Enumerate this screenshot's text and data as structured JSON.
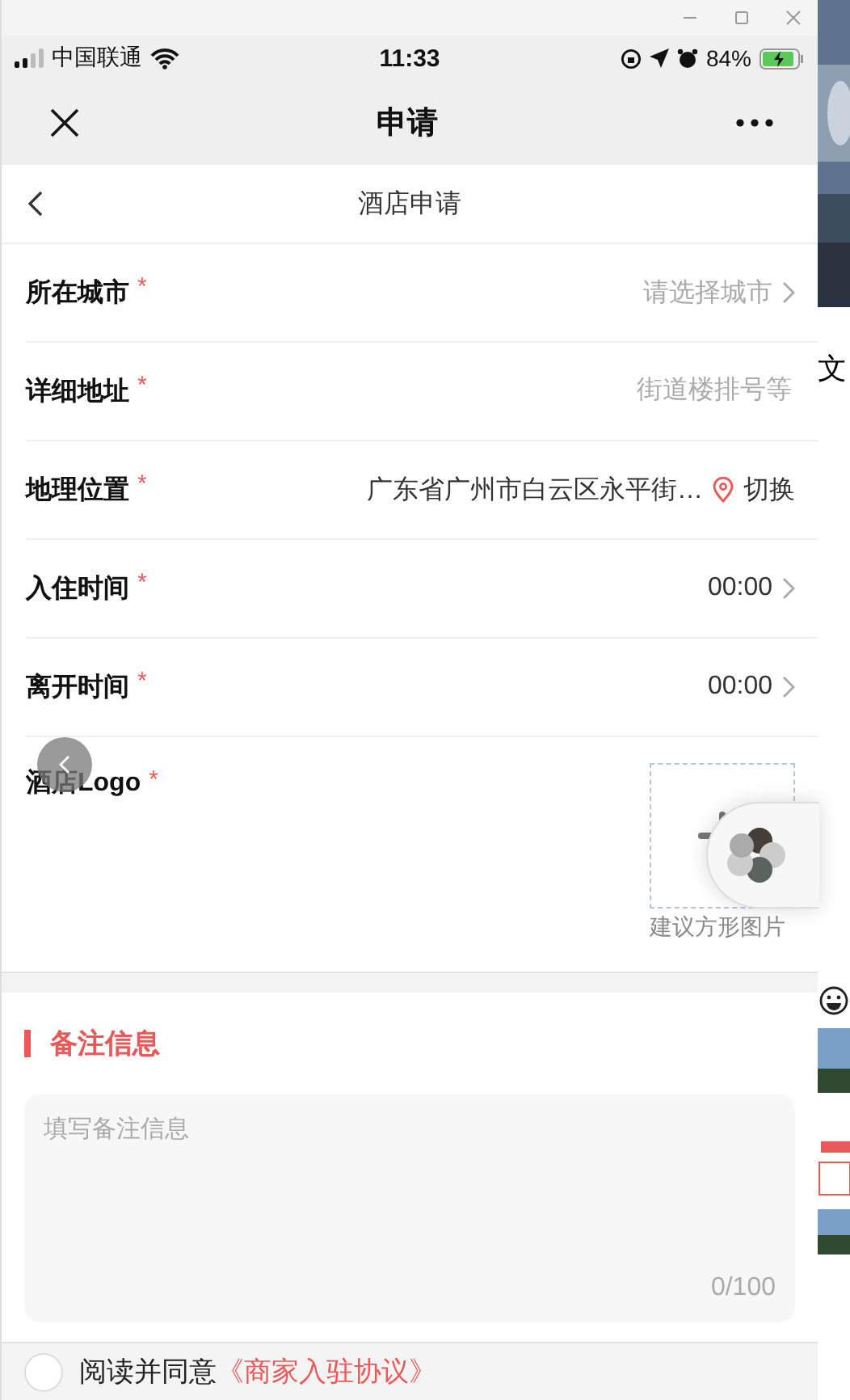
{
  "status_bar": {
    "carrier": "中国联通",
    "time": "11:33",
    "battery": "84%"
  },
  "nav": {
    "title": "申请"
  },
  "subheader": {
    "title": "酒店申请"
  },
  "fields": [
    {
      "kind": "select",
      "label": "所在城市",
      "required": true,
      "placeholder": "请选择城市"
    },
    {
      "kind": "input",
      "label": "详细地址",
      "required": true,
      "placeholder": "街道楼排号等"
    },
    {
      "kind": "location",
      "label": "地理位置",
      "required": true,
      "value": "广东省广州市白云区永平街…",
      "action": "切换"
    },
    {
      "kind": "select",
      "label": "入住时间",
      "required": true,
      "value": "00:00"
    },
    {
      "kind": "select",
      "label": "离开时间",
      "required": true,
      "value": "00:00"
    }
  ],
  "logo": {
    "label": "酒店Logo",
    "required": true,
    "hint": "建议方形图片"
  },
  "remarks": {
    "title": "备注信息",
    "placeholder": "填写备注信息",
    "counter": "0/100"
  },
  "agreement": {
    "checked": false,
    "text": "阅读并同意",
    "link": "《商家入驻协议》"
  },
  "side_pane": {
    "text": "文"
  },
  "required_mark": "*"
}
